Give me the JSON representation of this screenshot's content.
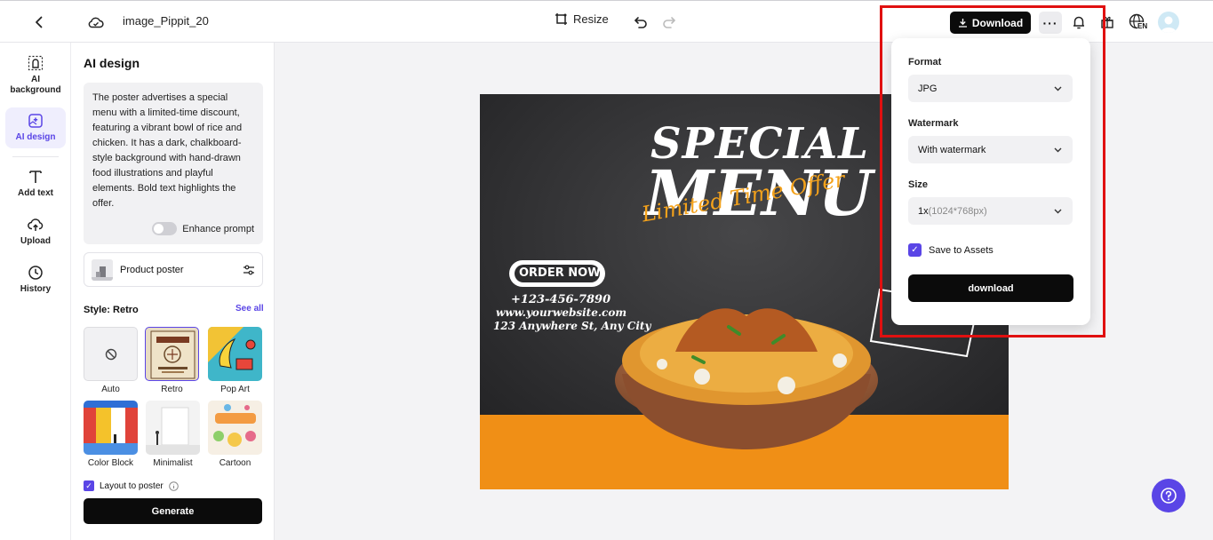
{
  "header": {
    "title": "image_Pippit_20",
    "resize_label": "Resize",
    "download_label": "Download",
    "more_label": "···",
    "language": "EN"
  },
  "rail": {
    "items": [
      {
        "label": "AI background",
        "icon": "ai-background-icon"
      },
      {
        "label": "AI design",
        "icon": "ai-design-icon",
        "active": true
      },
      {
        "label": "Add text",
        "icon": "text-icon"
      },
      {
        "label": "Upload",
        "icon": "upload-icon"
      },
      {
        "label": "History",
        "icon": "history-icon"
      }
    ]
  },
  "panel": {
    "title": "AI design",
    "prompt": "The poster advertises a special menu with a limited-time discount, featuring a vibrant bowl of rice and chicken. It has a dark, chalkboard-style background with hand-drawn food illustrations and playful elements. Bold text highlights the offer.",
    "enhance_label": "Enhance prompt",
    "enhance_enabled": false,
    "product_label": "Product poster",
    "style_label": "Style: Retro",
    "see_all": "See all",
    "styles": [
      {
        "label": "Auto"
      },
      {
        "label": "Retro",
        "selected": true
      },
      {
        "label": "Pop Art"
      },
      {
        "label": "Color Block"
      },
      {
        "label": "Minimalist"
      },
      {
        "label": "Cartoon"
      }
    ],
    "layout_label": "Layout to poster",
    "layout_checked": true,
    "generate_label": "Generate"
  },
  "poster": {
    "headline_1": "SPECIAL",
    "headline_2": "MENU",
    "tagline": "Limited Time Offer",
    "order_now": "ORDER NOW",
    "phone": "+123-456-7890",
    "website": "www.yourwebsite.com",
    "address": "123 Anywhere St, Any City"
  },
  "download_panel": {
    "format_label": "Format",
    "format_value": "JPG",
    "watermark_label": "Watermark",
    "watermark_value": "With watermark",
    "size_label": "Size",
    "size_value": "1x",
    "size_detail": "(1024*768px)",
    "save_label": "Save to Assets",
    "save_checked": true,
    "download_label": "download"
  },
  "colors": {
    "accent": "#5a45e6",
    "highlight": "#e01010",
    "poster_orange": "#f08f16"
  }
}
